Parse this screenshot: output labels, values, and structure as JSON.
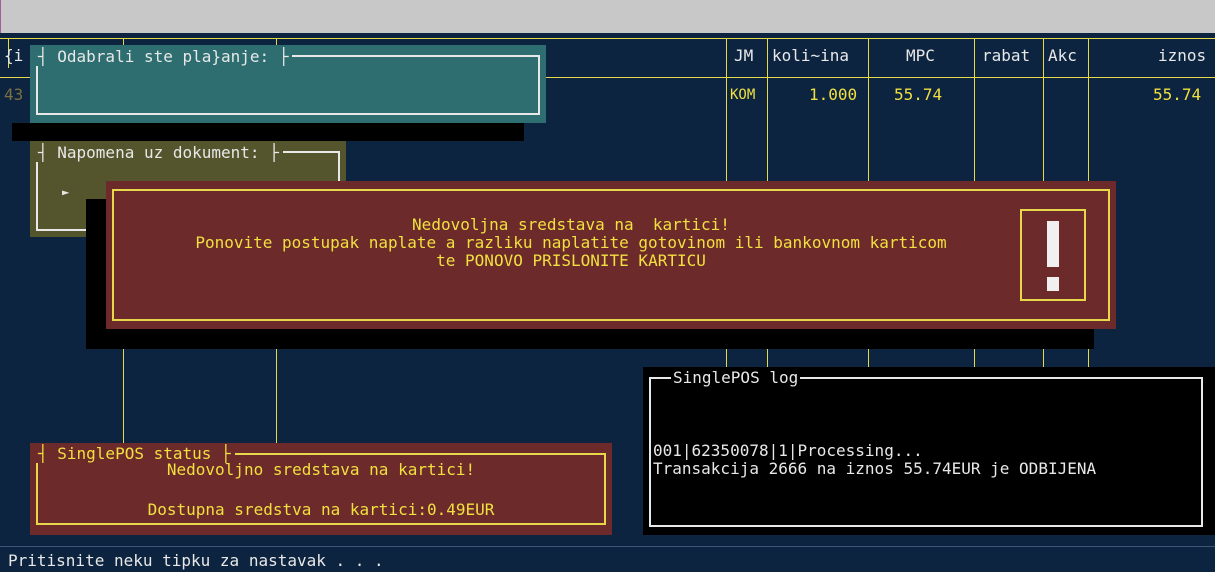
{
  "table": {
    "headers": {
      "jm": "JM",
      "kolicina": "koli~ina",
      "mpc": "MPC",
      "rabat": "rabat",
      "akc": "Akc",
      "iznos": "iznos",
      "first_col_fragment": "{i"
    },
    "row": {
      "first_col_fragment": "43",
      "jm": "KOM",
      "kolicina": "1.000",
      "mpc": "55.74",
      "iznos": "55.74"
    }
  },
  "payment_dialog": {
    "title": "Odabrali ste pla}anje:"
  },
  "note_dialog": {
    "title": "Napomena uz dokument:",
    "pointer": "►"
  },
  "alert": {
    "line1": "Nedovoljna sredstava na  kartici!",
    "line2": "Ponovite postupak naplate a razliku naplatite gotovinom ili bankovnom karticom",
    "line3": "te PONOVO PRISLONITE KARTICU",
    "icon": "exclamation-icon",
    "color": "#6d2a2a",
    "text_color": "#f0e040"
  },
  "singlepos_status": {
    "title": "SinglePOS status",
    "message": "Nedovoljno sredstava na kartici!",
    "available": "Dostupna sredstva na kartici:0.49EUR"
  },
  "singlepos_log": {
    "title": "SinglePOS log",
    "lines": [
      "001|62350078|1|Processing...",
      "Transakcija 2666 na iznos 55.74EUR je ODBIJENA"
    ]
  },
  "footer": {
    "prompt": "Pritisnite neku tipku za nastavak . . ."
  },
  "colors": {
    "background": "#0d2440",
    "teal": "#2e6e70",
    "olive": "#55552d",
    "red": "#6d2a2a",
    "grid": "#e6d84a"
  }
}
